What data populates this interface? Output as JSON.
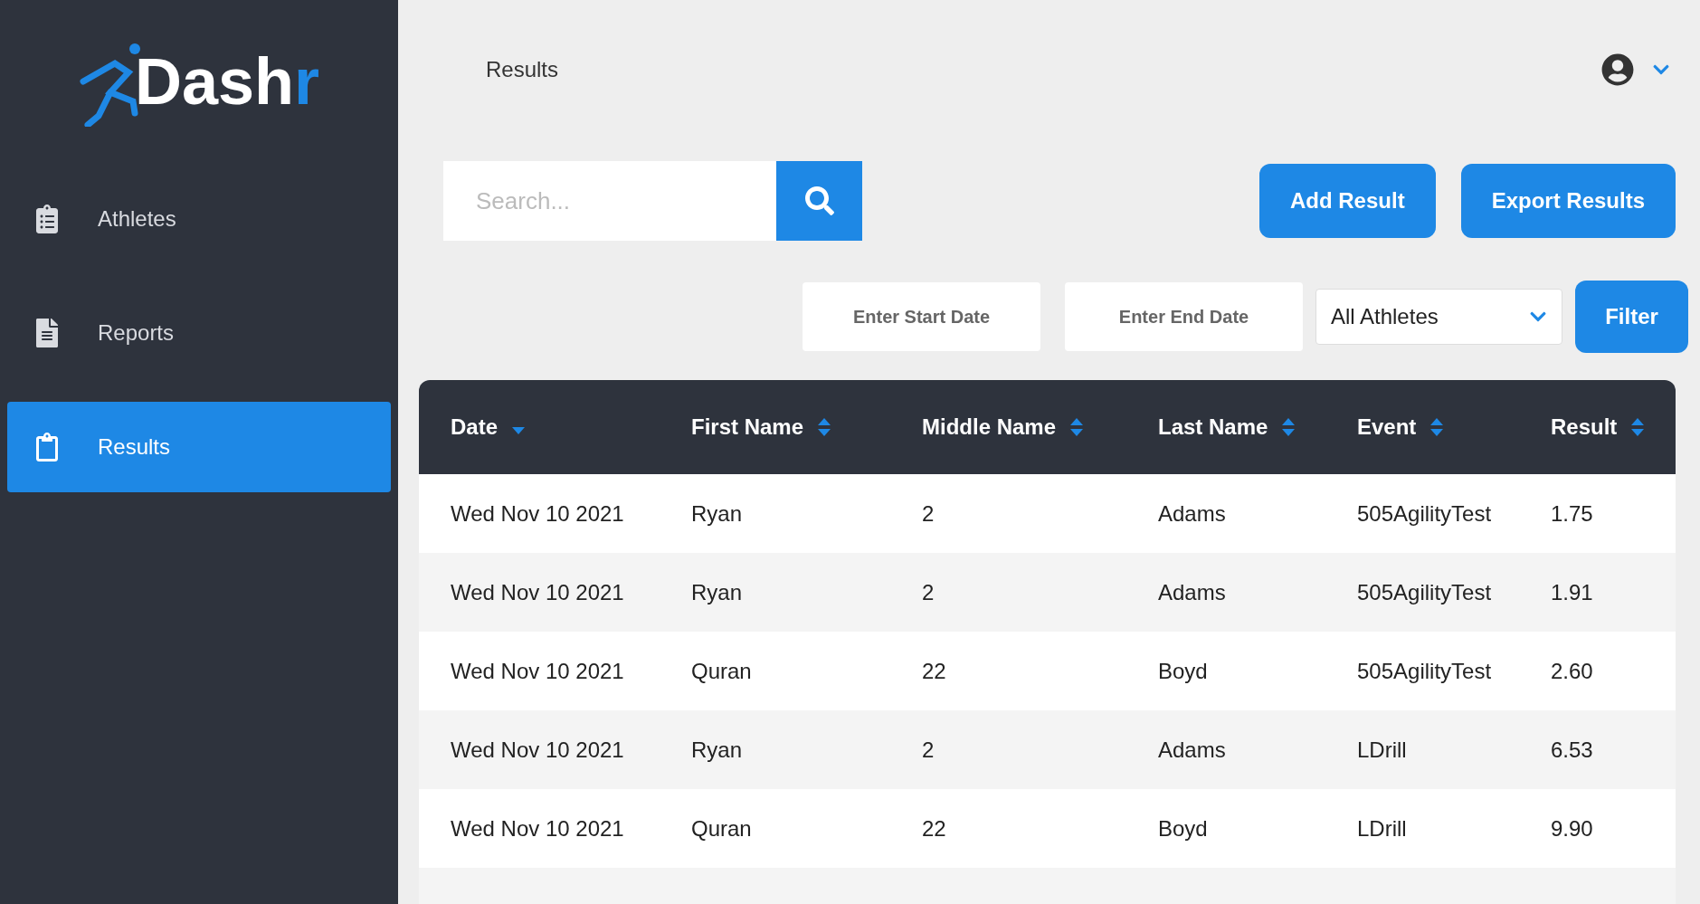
{
  "logo": [
    {
      "text": "Dash",
      "accent": false
    },
    {
      "text": "r",
      "accent": true
    }
  ],
  "sidebar": {
    "items": [
      {
        "label": "Athletes",
        "selected": false
      },
      {
        "label": "Reports",
        "selected": false
      },
      {
        "label": "Results",
        "selected": true
      }
    ]
  },
  "header": {
    "title": "Results"
  },
  "search": {
    "placeholder": "Search..."
  },
  "actions": [
    "Add Result",
    "Export Results"
  ],
  "filters": {
    "start_date": {
      "placeholder": "Enter Start Date"
    },
    "end_date": {
      "placeholder": "Enter End Date"
    },
    "athlete": {
      "value": "All Athletes"
    },
    "button": "Filter"
  },
  "table": {
    "columns": [
      {
        "label": "Date",
        "sorted": true
      },
      {
        "label": "First Name",
        "sorted": false
      },
      {
        "label": "Middle Name",
        "sorted": false
      },
      {
        "label": "Last Name",
        "sorted": false
      },
      {
        "label": "Event",
        "sorted": false
      },
      {
        "label": "Result",
        "sorted": false
      }
    ],
    "rows": [
      [
        "Wed Nov 10 2021",
        "Ryan",
        "2",
        "Adams",
        "505AgilityTest",
        "1.75"
      ],
      [
        "Wed Nov 10 2021",
        "Ryan",
        "2",
        "Adams",
        "505AgilityTest",
        "1.91"
      ],
      [
        "Wed Nov 10 2021",
        "Quran",
        "22",
        "Boyd",
        "505AgilityTest",
        "2.60"
      ],
      [
        "Wed Nov 10 2021",
        "Ryan",
        "2",
        "Adams",
        "LDrill",
        "6.53"
      ],
      [
        "Wed Nov 10 2021",
        "Quran",
        "22",
        "Boyd",
        "LDrill",
        "9.90"
      ]
    ]
  }
}
